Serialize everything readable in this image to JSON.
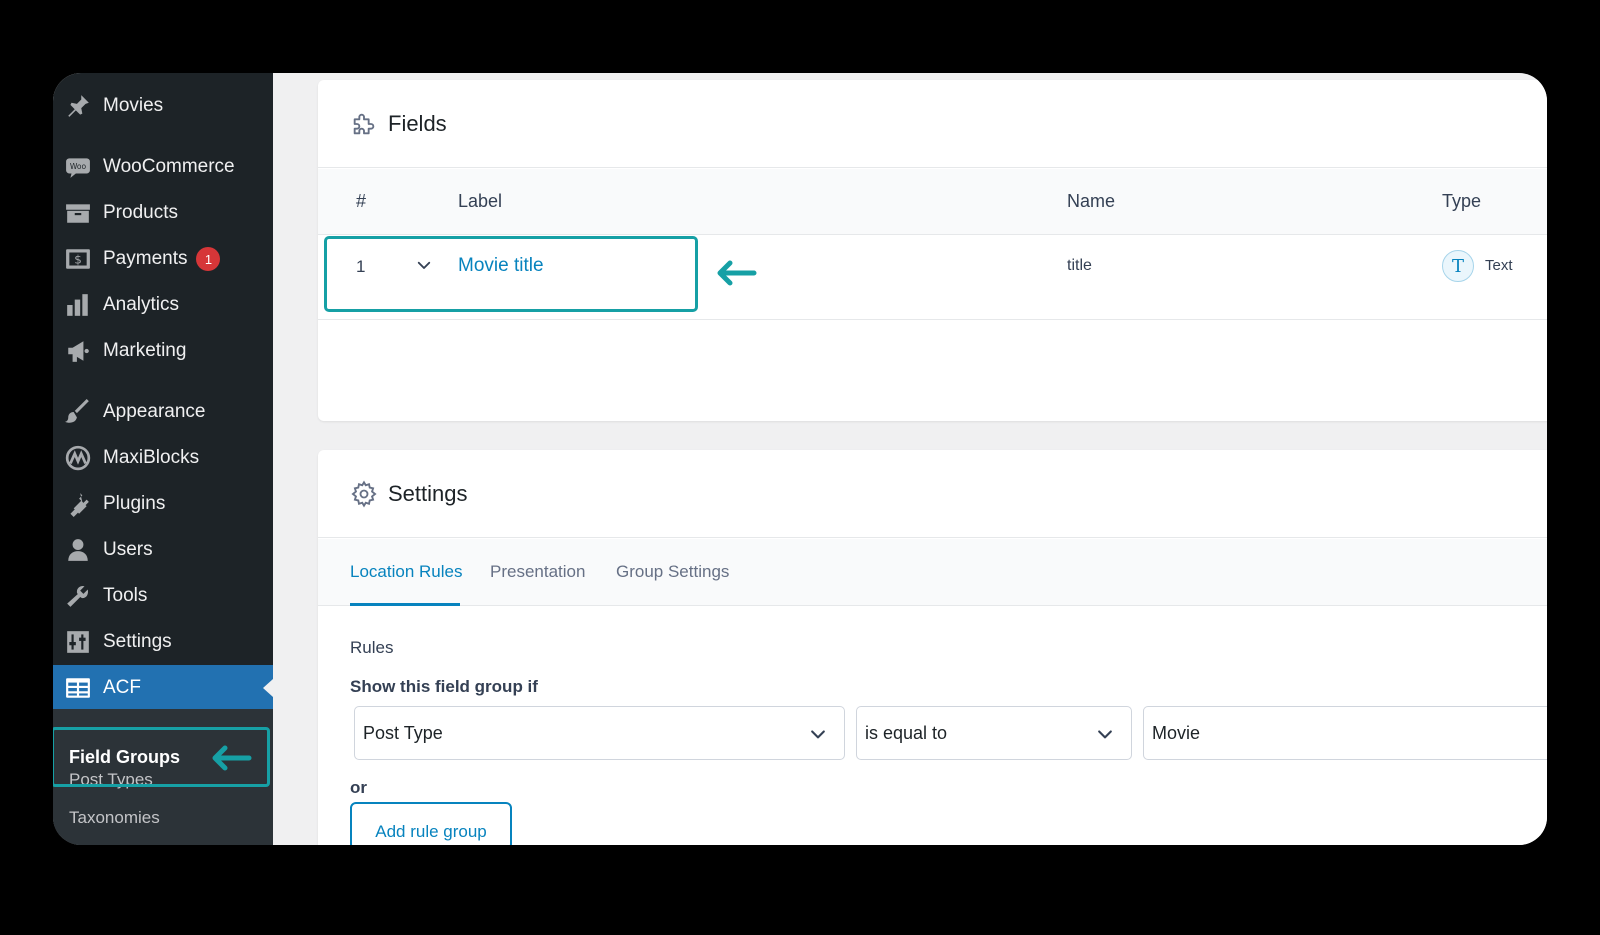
{
  "sidebar": {
    "items": [
      {
        "label": "Movies",
        "icon": "pin-icon"
      },
      {
        "label": "WooCommerce",
        "icon": "woo-icon"
      },
      {
        "label": "Products",
        "icon": "archive-icon"
      },
      {
        "label": "Payments",
        "icon": "dollar-icon",
        "badge": "1"
      },
      {
        "label": "Analytics",
        "icon": "chart-bar-icon"
      },
      {
        "label": "Marketing",
        "icon": "megaphone-icon"
      },
      {
        "label": "Appearance",
        "icon": "paintbrush-icon"
      },
      {
        "label": "MaxiBlocks",
        "icon": "maxiblocks-icon"
      },
      {
        "label": "Plugins",
        "icon": "plug-icon"
      },
      {
        "label": "Users",
        "icon": "user-icon"
      },
      {
        "label": "Tools",
        "icon": "wrench-icon"
      },
      {
        "label": "Settings",
        "icon": "sliders-icon"
      },
      {
        "label": "ACF",
        "icon": "table-icon"
      }
    ],
    "submenu": {
      "current": "Field Groups",
      "items": [
        "Post Types",
        "Taxonomies"
      ]
    }
  },
  "fields_panel": {
    "title": "Fields",
    "columns": [
      "#",
      "Label",
      "Name",
      "Type"
    ],
    "rows": [
      {
        "number": "1",
        "label": "Movie title",
        "name": "title",
        "type": "Text",
        "type_icon": "T"
      }
    ]
  },
  "settings_panel": {
    "title": "Settings",
    "tabs": [
      "Location Rules",
      "Presentation",
      "Group Settings"
    ],
    "rules_label": "Rules",
    "show_if_label": "Show this field group if",
    "rule": {
      "param": "Post Type",
      "operator": "is equal to",
      "value": "Movie"
    },
    "or_label": "or",
    "add_rule_group": "Add rule group"
  },
  "colors": {
    "accent": "#16a0a5",
    "wp_blue": "#2271b1",
    "link": "#0783be",
    "sidebar_bg": "#1d2327",
    "badge": "#d63638"
  }
}
